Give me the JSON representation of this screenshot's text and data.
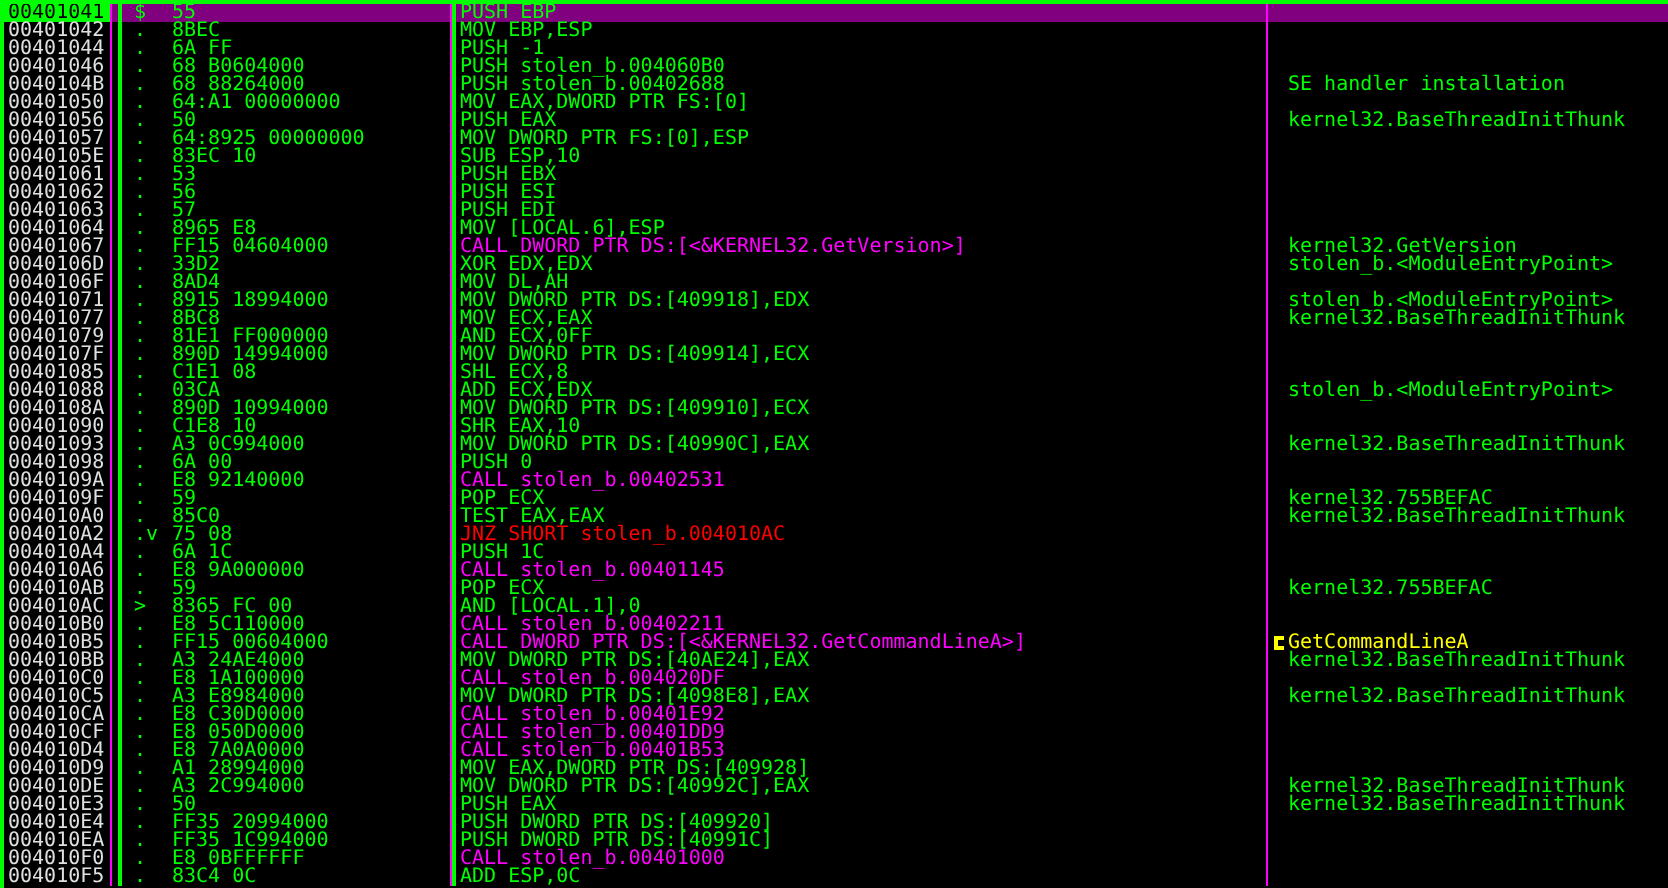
{
  "rows": [
    {
      "address": "00401041",
      "marker": "$",
      "hex": "55",
      "instruction": "PUSH EBP",
      "kind": "normal",
      "selected": true
    },
    {
      "address": "00401042",
      "marker": ".",
      "hex": "8BEC",
      "instruction": "MOV EBP,ESP",
      "kind": "normal",
      "selected": false
    },
    {
      "address": "00401044",
      "marker": ".",
      "hex": "6A FF",
      "instruction": "PUSH -1",
      "kind": "normal",
      "selected": false
    },
    {
      "address": "00401046",
      "marker": ".",
      "hex": "68 B0604000",
      "instruction": "PUSH stolen_b.004060B0",
      "kind": "normal",
      "selected": false
    },
    {
      "address": "0040104B",
      "marker": ".",
      "hex": "68 88264000",
      "instruction": "PUSH stolen_b.00402688",
      "kind": "normal",
      "selected": false,
      "comment": {
        "text": "SE handler installation",
        "kind": "plain"
      }
    },
    {
      "address": "00401050",
      "marker": ".",
      "hex": "64:A1 00000000",
      "instruction": "MOV EAX,DWORD PTR FS:[0]",
      "kind": "normal",
      "selected": false
    },
    {
      "address": "00401056",
      "marker": ".",
      "hex": "50",
      "instruction": "PUSH EAX",
      "kind": "normal",
      "selected": false,
      "comment": {
        "text": "kernel32.BaseThreadInitThunk",
        "kind": "plain"
      }
    },
    {
      "address": "00401057",
      "marker": ".",
      "hex": "64:8925 00000000",
      "instruction": "MOV DWORD PTR FS:[0],ESP",
      "kind": "normal",
      "selected": false
    },
    {
      "address": "0040105E",
      "marker": ".",
      "hex": "83EC 10",
      "instruction": "SUB ESP,10",
      "kind": "normal",
      "selected": false
    },
    {
      "address": "00401061",
      "marker": ".",
      "hex": "53",
      "instruction": "PUSH EBX",
      "kind": "normal",
      "selected": false
    },
    {
      "address": "00401062",
      "marker": ".",
      "hex": "56",
      "instruction": "PUSH ESI",
      "kind": "normal",
      "selected": false
    },
    {
      "address": "00401063",
      "marker": ".",
      "hex": "57",
      "instruction": "PUSH EDI",
      "kind": "normal",
      "selected": false
    },
    {
      "address": "00401064",
      "marker": ".",
      "hex": "8965 E8",
      "instruction": "MOV [LOCAL.6],ESP",
      "kind": "normal",
      "selected": false
    },
    {
      "address": "00401067",
      "marker": ".",
      "hex": "FF15 04604000",
      "instruction": "CALL DWORD PTR DS:[<&KERNEL32.GetVersion>]",
      "kind": "call",
      "selected": false,
      "comment": {
        "text": "kernel32.GetVersion",
        "kind": "plain"
      }
    },
    {
      "address": "0040106D",
      "marker": ".",
      "hex": "33D2",
      "instruction": "XOR EDX,EDX",
      "kind": "normal",
      "selected": false,
      "comment": {
        "text": "stolen_b.<ModuleEntryPoint>",
        "kind": "plain"
      }
    },
    {
      "address": "0040106F",
      "marker": ".",
      "hex": "8AD4",
      "instruction": "MOV DL,AH",
      "kind": "normal",
      "selected": false
    },
    {
      "address": "00401071",
      "marker": ".",
      "hex": "8915 18994000",
      "instruction": "MOV DWORD PTR DS:[409918],EDX",
      "kind": "normal",
      "selected": false,
      "comment": {
        "text": "stolen_b.<ModuleEntryPoint>",
        "kind": "plain"
      }
    },
    {
      "address": "00401077",
      "marker": ".",
      "hex": "8BC8",
      "instruction": "MOV ECX,EAX",
      "kind": "normal",
      "selected": false,
      "comment": {
        "text": "kernel32.BaseThreadInitThunk",
        "kind": "plain"
      }
    },
    {
      "address": "00401079",
      "marker": ".",
      "hex": "81E1 FF000000",
      "instruction": "AND ECX,0FF",
      "kind": "normal",
      "selected": false
    },
    {
      "address": "0040107F",
      "marker": ".",
      "hex": "890D 14994000",
      "instruction": "MOV DWORD PTR DS:[409914],ECX",
      "kind": "normal",
      "selected": false
    },
    {
      "address": "00401085",
      "marker": ".",
      "hex": "C1E1 08",
      "instruction": "SHL ECX,8",
      "kind": "normal",
      "selected": false
    },
    {
      "address": "00401088",
      "marker": ".",
      "hex": "03CA",
      "instruction": "ADD ECX,EDX",
      "kind": "normal",
      "selected": false,
      "comment": {
        "text": "stolen_b.<ModuleEntryPoint>",
        "kind": "plain"
      }
    },
    {
      "address": "0040108A",
      "marker": ".",
      "hex": "890D 10994000",
      "instruction": "MOV DWORD PTR DS:[409910],ECX",
      "kind": "normal",
      "selected": false
    },
    {
      "address": "00401090",
      "marker": ".",
      "hex": "C1E8 10",
      "instruction": "SHR EAX,10",
      "kind": "normal",
      "selected": false
    },
    {
      "address": "00401093",
      "marker": ".",
      "hex": "A3 0C994000",
      "instruction": "MOV DWORD PTR DS:[40990C],EAX",
      "kind": "normal",
      "selected": false,
      "comment": {
        "text": "kernel32.BaseThreadInitThunk",
        "kind": "plain"
      }
    },
    {
      "address": "00401098",
      "marker": ".",
      "hex": "6A 00",
      "instruction": "PUSH 0",
      "kind": "normal",
      "selected": false
    },
    {
      "address": "0040109A",
      "marker": ".",
      "hex": "E8 92140000",
      "instruction": "CALL stolen_b.00402531",
      "kind": "call",
      "selected": false
    },
    {
      "address": "0040109F",
      "marker": ".",
      "hex": "59",
      "instruction": "POP ECX",
      "kind": "normal",
      "selected": false,
      "comment": {
        "text": "kernel32.755BEFAC",
        "kind": "plain"
      }
    },
    {
      "address": "004010A0",
      "marker": ".",
      "hex": "85C0",
      "instruction": "TEST EAX,EAX",
      "kind": "normal",
      "selected": false,
      "comment": {
        "text": "kernel32.BaseThreadInitThunk",
        "kind": "plain"
      }
    },
    {
      "address": "004010A2",
      "marker": ".v",
      "hex": "75 08",
      "instruction": "JNZ SHORT stolen_b.004010AC",
      "kind": "jump",
      "selected": false
    },
    {
      "address": "004010A4",
      "marker": ".",
      "hex": "6A 1C",
      "instruction": "PUSH 1C",
      "kind": "normal",
      "selected": false
    },
    {
      "address": "004010A6",
      "marker": ".",
      "hex": "E8 9A000000",
      "instruction": "CALL stolen_b.00401145",
      "kind": "call",
      "selected": false
    },
    {
      "address": "004010AB",
      "marker": ".",
      "hex": "59",
      "instruction": "POP ECX",
      "kind": "normal",
      "selected": false,
      "comment": {
        "text": "kernel32.755BEFAC",
        "kind": "plain"
      }
    },
    {
      "address": "004010AC",
      "marker": ">",
      "hex": "8365 FC 00",
      "instruction": "AND [LOCAL.1],0",
      "kind": "normal",
      "selected": false
    },
    {
      "address": "004010B0",
      "marker": ".",
      "hex": "E8 5C110000",
      "instruction": "CALL stolen_b.00402211",
      "kind": "call",
      "selected": false
    },
    {
      "address": "004010B5",
      "marker": ".",
      "hex": "FF15 00604000",
      "instruction": "CALL DWORD PTR DS:[<&KERNEL32.GetCommandLineA>]",
      "kind": "call",
      "selected": false,
      "comment": {
        "text": "GetCommandLineA",
        "kind": "api"
      }
    },
    {
      "address": "004010BB",
      "marker": ".",
      "hex": "A3 24AE4000",
      "instruction": "MOV DWORD PTR DS:[40AE24],EAX",
      "kind": "normal",
      "selected": false,
      "comment": {
        "text": "kernel32.BaseThreadInitThunk",
        "kind": "plain"
      }
    },
    {
      "address": "004010C0",
      "marker": ".",
      "hex": "E8 1A100000",
      "instruction": "CALL stolen_b.004020DF",
      "kind": "call",
      "selected": false
    },
    {
      "address": "004010C5",
      "marker": ".",
      "hex": "A3 E8984000",
      "instruction": "MOV DWORD PTR DS:[4098E8],EAX",
      "kind": "normal",
      "selected": false,
      "comment": {
        "text": "kernel32.BaseThreadInitThunk",
        "kind": "plain"
      }
    },
    {
      "address": "004010CA",
      "marker": ".",
      "hex": "E8 C30D0000",
      "instruction": "CALL stolen_b.00401E92",
      "kind": "call",
      "selected": false
    },
    {
      "address": "004010CF",
      "marker": ".",
      "hex": "E8 050D0000",
      "instruction": "CALL stolen_b.00401DD9",
      "kind": "call",
      "selected": false
    },
    {
      "address": "004010D4",
      "marker": ".",
      "hex": "E8 7A0A0000",
      "instruction": "CALL stolen_b.00401B53",
      "kind": "call",
      "selected": false
    },
    {
      "address": "004010D9",
      "marker": ".",
      "hex": "A1 28994000",
      "instruction": "MOV EAX,DWORD PTR DS:[409928]",
      "kind": "normal",
      "selected": false
    },
    {
      "address": "004010DE",
      "marker": ".",
      "hex": "A3 2C994000",
      "instruction": "MOV DWORD PTR DS:[40992C],EAX",
      "kind": "normal",
      "selected": false,
      "comment": {
        "text": "kernel32.BaseThreadInitThunk",
        "kind": "plain"
      }
    },
    {
      "address": "004010E3",
      "marker": ".",
      "hex": "50",
      "instruction": "PUSH EAX",
      "kind": "normal",
      "selected": false,
      "comment": {
        "text": "kernel32.BaseThreadInitThunk",
        "kind": "plain"
      }
    },
    {
      "address": "004010E4",
      "marker": ".",
      "hex": "FF35 20994000",
      "instruction": "PUSH DWORD PTR DS:[409920]",
      "kind": "normal",
      "selected": false
    },
    {
      "address": "004010EA",
      "marker": ".",
      "hex": "FF35 1C994000",
      "instruction": "PUSH DWORD PTR DS:[40991C]",
      "kind": "normal",
      "selected": false
    },
    {
      "address": "004010F0",
      "marker": ".",
      "hex": "E8 0BFFFFFF",
      "instruction": "CALL stolen_b.00401000",
      "kind": "call",
      "selected": false
    },
    {
      "address": "004010F5",
      "marker": ".",
      "hex": "83C4 0C",
      "instruction": "ADD ESP,0C",
      "kind": "normal",
      "selected": false
    }
  ]
}
